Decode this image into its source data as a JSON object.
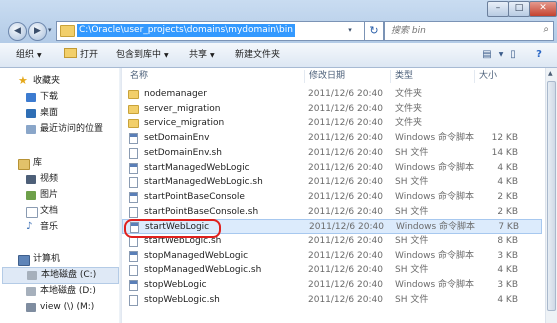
{
  "window": {
    "address_path": "C:\\Oracle\\user_projects\\domains\\mydomain\\bin",
    "search_placeholder": "搜索 bin",
    "caption": {
      "minimize": "–",
      "maximize": "□",
      "close": "✕"
    },
    "nav_buttons": {
      "back": "◀",
      "forward": "▶",
      "recent": "▾",
      "refresh": "↻"
    }
  },
  "toolbar": {
    "organize": "组织",
    "open": "打开",
    "include_in_library": "包含到库中",
    "share": "共享",
    "new_folder": "新建文件夹"
  },
  "nav": {
    "favorites": {
      "label": "收藏夹",
      "items": [
        "下载",
        "桌面",
        "最近访问的位置"
      ]
    },
    "libraries": {
      "label": "库",
      "items": [
        "视频",
        "图片",
        "文档",
        "音乐"
      ]
    },
    "computer": {
      "label": "计算机",
      "items": [
        "本地磁盘 (C:)",
        "本地磁盘 (D:)",
        "view (\\) (M:)"
      ]
    }
  },
  "columns": {
    "name": "名称",
    "date": "修改日期",
    "type": "类型",
    "size": "大小"
  },
  "files": [
    {
      "name": "nodemanager",
      "date": "2011/12/6 20:40",
      "type": "文件夹",
      "size": "",
      "kind": "folder"
    },
    {
      "name": "server_migration",
      "date": "2011/12/6 20:40",
      "type": "文件夹",
      "size": "",
      "kind": "folder"
    },
    {
      "name": "service_migration",
      "date": "2011/12/6 20:40",
      "type": "文件夹",
      "size": "",
      "kind": "folder"
    },
    {
      "name": "setDomainEnv",
      "date": "2011/12/6 20:40",
      "type": "Windows 命令脚本",
      "size": "12 KB",
      "kind": "cmd"
    },
    {
      "name": "setDomainEnv.sh",
      "date": "2011/12/6 20:40",
      "type": "SH 文件",
      "size": "14 KB",
      "kind": "sh"
    },
    {
      "name": "startManagedWebLogic",
      "date": "2011/12/6 20:40",
      "type": "Windows 命令脚本",
      "size": "4 KB",
      "kind": "cmd"
    },
    {
      "name": "startManagedWebLogic.sh",
      "date": "2011/12/6 20:40",
      "type": "SH 文件",
      "size": "4 KB",
      "kind": "sh"
    },
    {
      "name": "startPointBaseConsole",
      "date": "2011/12/6 20:40",
      "type": "Windows 命令脚本",
      "size": "2 KB",
      "kind": "cmd"
    },
    {
      "name": "startPointBaseConsole.sh",
      "date": "2011/12/6 20:40",
      "type": "SH 文件",
      "size": "2 KB",
      "kind": "sh"
    },
    {
      "name": "startWebLogic",
      "date": "2011/12/6 20:40",
      "type": "Windows 命令脚本",
      "size": "7 KB",
      "kind": "cmd"
    },
    {
      "name": "startWebLogic.sh",
      "date": "2011/12/6 20:40",
      "type": "SH 文件",
      "size": "8 KB",
      "kind": "sh"
    },
    {
      "name": "stopManagedWebLogic",
      "date": "2011/12/6 20:40",
      "type": "Windows 命令脚本",
      "size": "3 KB",
      "kind": "cmd"
    },
    {
      "name": "stopManagedWebLogic.sh",
      "date": "2011/12/6 20:40",
      "type": "SH 文件",
      "size": "4 KB",
      "kind": "sh"
    },
    {
      "name": "stopWebLogic",
      "date": "2011/12/6 20:40",
      "type": "Windows 命令脚本",
      "size": "3 KB",
      "kind": "cmd"
    },
    {
      "name": "stopWebLogic.sh",
      "date": "2011/12/6 20:40",
      "type": "SH 文件",
      "size": "4 KB",
      "kind": "sh"
    }
  ],
  "colors": {
    "selection": "#3399ff",
    "highlight_box": "#e0201d",
    "row_selected": "#dcebfc"
  }
}
